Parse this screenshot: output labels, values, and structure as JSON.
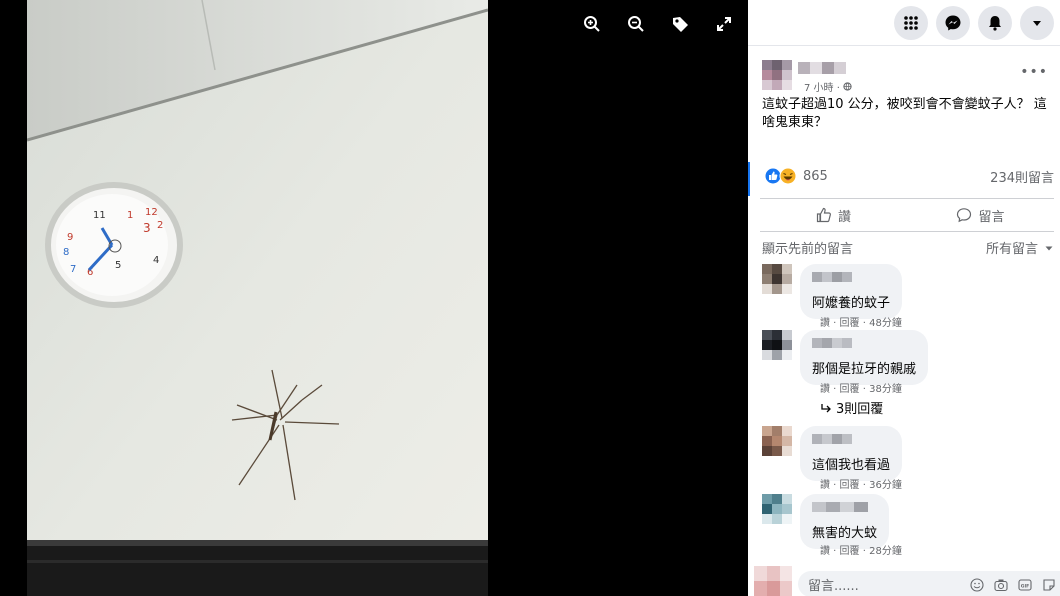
{
  "topbar": {
    "icons": [
      "apps-grid-icon",
      "messenger-icon",
      "notifications-bell-icon",
      "account-dropdown-icon"
    ]
  },
  "viewer": {
    "tools": [
      "zoom-in-icon",
      "zoom-out-icon",
      "tag-icon",
      "fullscreen-icon"
    ]
  },
  "post": {
    "time": "7 小時 ·",
    "text": "這蚊子超過10 公分，被咬到會不會變蚊子人？ 這啥鬼東東？",
    "reaction_count": "865",
    "comment_count": "234則留言",
    "like_label": "讚",
    "comment_label": "留言"
  },
  "comments_section": {
    "previous_label": "顯示先前的留言",
    "filter_label": "所有留言"
  },
  "comments": [
    {
      "text": "阿嬤養的蚊子",
      "like": "讚",
      "reply": "回覆",
      "time": "48分鐘"
    },
    {
      "text": "那個是拉牙的親戚",
      "like": "讚",
      "reply": "回覆",
      "time": "38分鐘",
      "replies": "3則回覆"
    },
    {
      "text": "這個我也看過",
      "like": "讚",
      "reply": "回覆",
      "time": "36分鐘"
    },
    {
      "text": "無害的大蚊",
      "like": "讚",
      "reply": "回覆",
      "time": "28分鐘"
    }
  ],
  "composer": {
    "placeholder": "留言......",
    "icons": [
      "emoji-icon",
      "camera-icon",
      "gif-icon",
      "sticker-icon"
    ]
  },
  "colors": {
    "accent": "#1877f2",
    "like": "#1877f2",
    "haha": "#f7b125"
  }
}
